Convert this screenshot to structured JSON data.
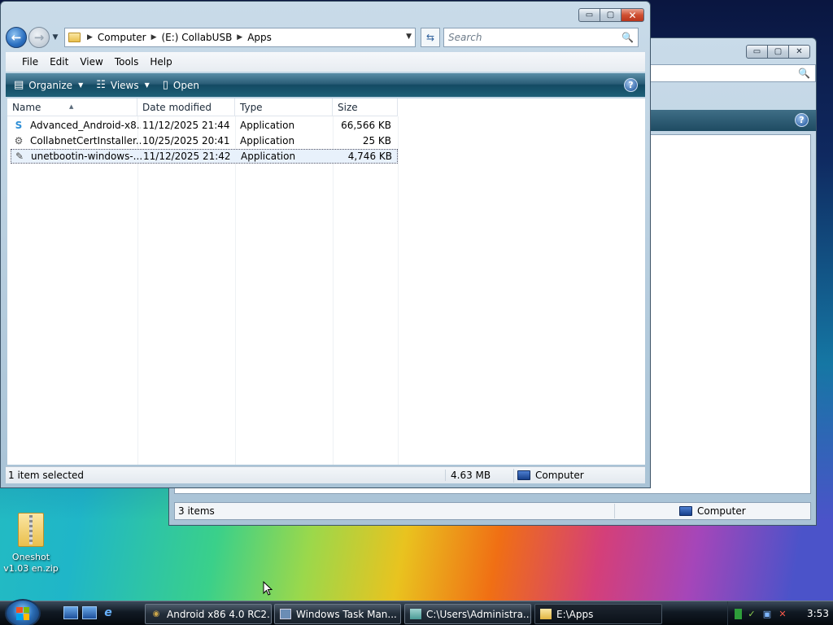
{
  "explorer": {
    "title_buttons": {
      "minimize": "▭",
      "maximize": "▢",
      "close": "✕"
    },
    "address": {
      "segments": [
        "Computer",
        "(E:) CollabUSB",
        "Apps"
      ],
      "search_placeholder": "Search"
    },
    "menu": [
      "File",
      "Edit",
      "View",
      "Tools",
      "Help"
    ],
    "commands": {
      "organize": "Organize",
      "views": "Views",
      "open": "Open",
      "help": "?"
    },
    "columns": [
      "Name",
      "Date modified",
      "Type",
      "Size"
    ],
    "files": [
      {
        "name": "Advanced_Android-x8...",
        "date": "11/12/2025 21:44",
        "type": "Application",
        "size": "66,566 KB",
        "icon": "android-installer-icon"
      },
      {
        "name": "CollabnetCertInstaller....",
        "date": "10/25/2025 20:41",
        "type": "Application",
        "size": "25 KB",
        "icon": "certificate-installer-icon"
      },
      {
        "name": "unetbootin-windows-...",
        "date": "11/12/2025 21:42",
        "type": "Application",
        "size": "4,746 KB",
        "icon": "unetbootin-icon",
        "selected": true
      }
    ],
    "status": {
      "selection": "1 item selected",
      "size": "4.63 MB",
      "location": "Computer"
    }
  },
  "background_window": {
    "help": "?",
    "status": {
      "count": "3 items",
      "location": "Computer"
    }
  },
  "desktop": {
    "icons": [
      {
        "label": "Oneshot v1.03 en.zip",
        "icon": "zip-folder-icon"
      }
    ]
  },
  "taskbar": {
    "quick_launch": [
      "show-desktop-icon",
      "switch-windows-icon",
      "internet-explorer-icon"
    ],
    "buttons": [
      {
        "label": "Android x86 4.0 RC2...",
        "icon": "android-icon"
      },
      {
        "label": "Windows Task Man...",
        "icon": "task-manager-icon"
      },
      {
        "label": "C:\\Users\\Administra...",
        "icon": "folder-icon"
      },
      {
        "label": "E:\\Apps",
        "icon": "folder-icon",
        "active": true
      }
    ],
    "tray_icons": [
      "battery-icon",
      "safety-icon",
      "network-icon",
      "volume-muted-icon"
    ],
    "clock": "3:53"
  },
  "colors": {
    "accent": "#2a5d77",
    "selection": "#e8f1fb",
    "taskbar": "#111a24"
  }
}
